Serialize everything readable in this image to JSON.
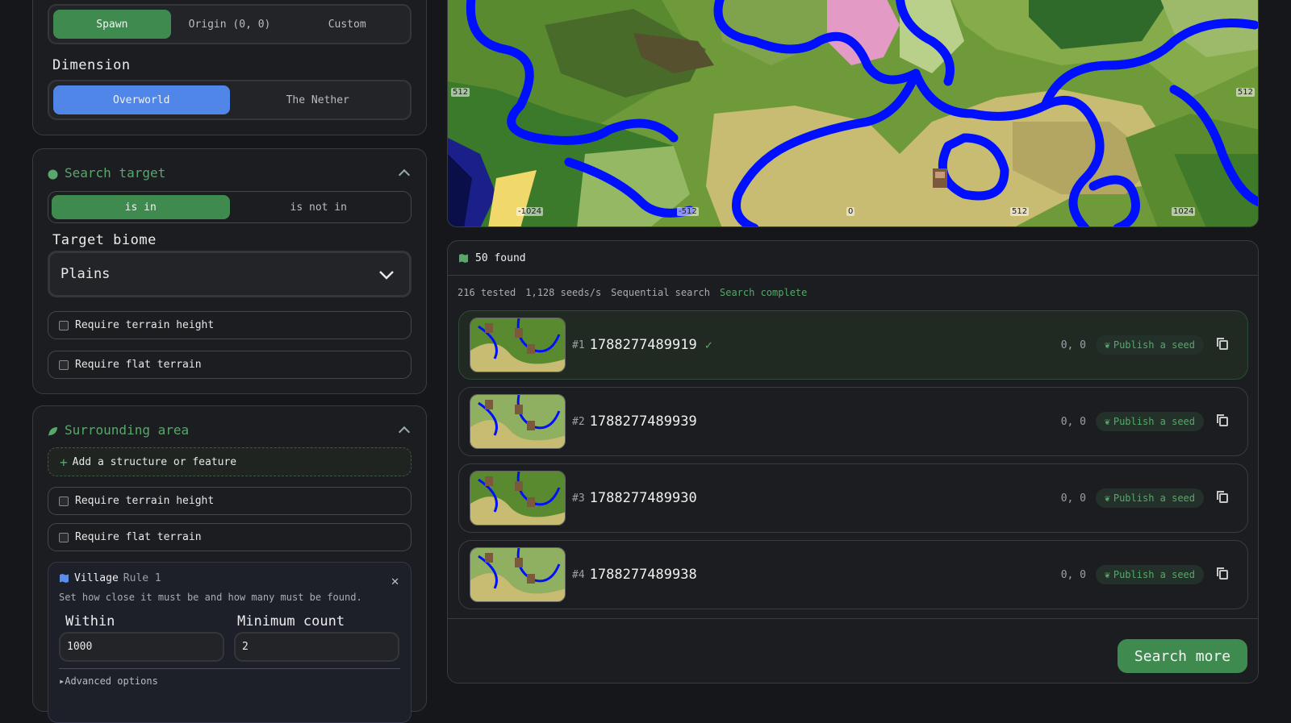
{
  "origin": {
    "options": [
      "Spawn",
      "Origin (0, 0)",
      "Custom"
    ],
    "selected": "Spawn"
  },
  "dimension": {
    "label": "Dimension",
    "options": [
      "Overworld",
      "The Nether"
    ],
    "selected": "Overworld"
  },
  "search_target": {
    "title": "Search target",
    "mode_options": [
      "is in",
      "is not in"
    ],
    "mode_selected": "is in",
    "biome_label": "Target biome",
    "biome_value": "Plains",
    "require_height": "Require terrain height",
    "require_flat": "Require flat terrain"
  },
  "surrounding": {
    "title": "Surrounding area",
    "add_label": "Add a structure or feature",
    "require_height": "Require terrain height",
    "require_flat": "Require flat terrain",
    "rule": {
      "name": "Village",
      "tag": "Rule 1",
      "description": "Set how close it must be and how many must be found.",
      "within_label": "Within",
      "within_value": "1000",
      "min_label": "Minimum count",
      "min_value": "2",
      "advanced": "Advanced options"
    }
  },
  "map": {
    "x_ticks": [
      "-1024",
      "-512",
      "0",
      "512",
      "1024"
    ],
    "y_tick_left": "512",
    "y_tick_right": "512"
  },
  "results": {
    "found": "50 found",
    "tested": "216 tested",
    "rate": "1,128 seeds/s",
    "mode": "Sequential search",
    "status": "Search complete",
    "publish_label": "Publish a seed",
    "more_label": "Search more",
    "items": [
      {
        "rank": "#1",
        "seed": "1788277489919",
        "coords": "0, 0",
        "selected": true
      },
      {
        "rank": "#2",
        "seed": "1788277489939",
        "coords": "0, 0",
        "selected": false
      },
      {
        "rank": "#3",
        "seed": "1788277489930",
        "coords": "0, 0",
        "selected": false
      },
      {
        "rank": "#4",
        "seed": "1788277489938",
        "coords": "0, 0",
        "selected": false
      }
    ]
  },
  "colors": {
    "accent_green": "#3f8a4f",
    "accent_blue": "#4f86e8",
    "text_green": "#57a86a"
  }
}
